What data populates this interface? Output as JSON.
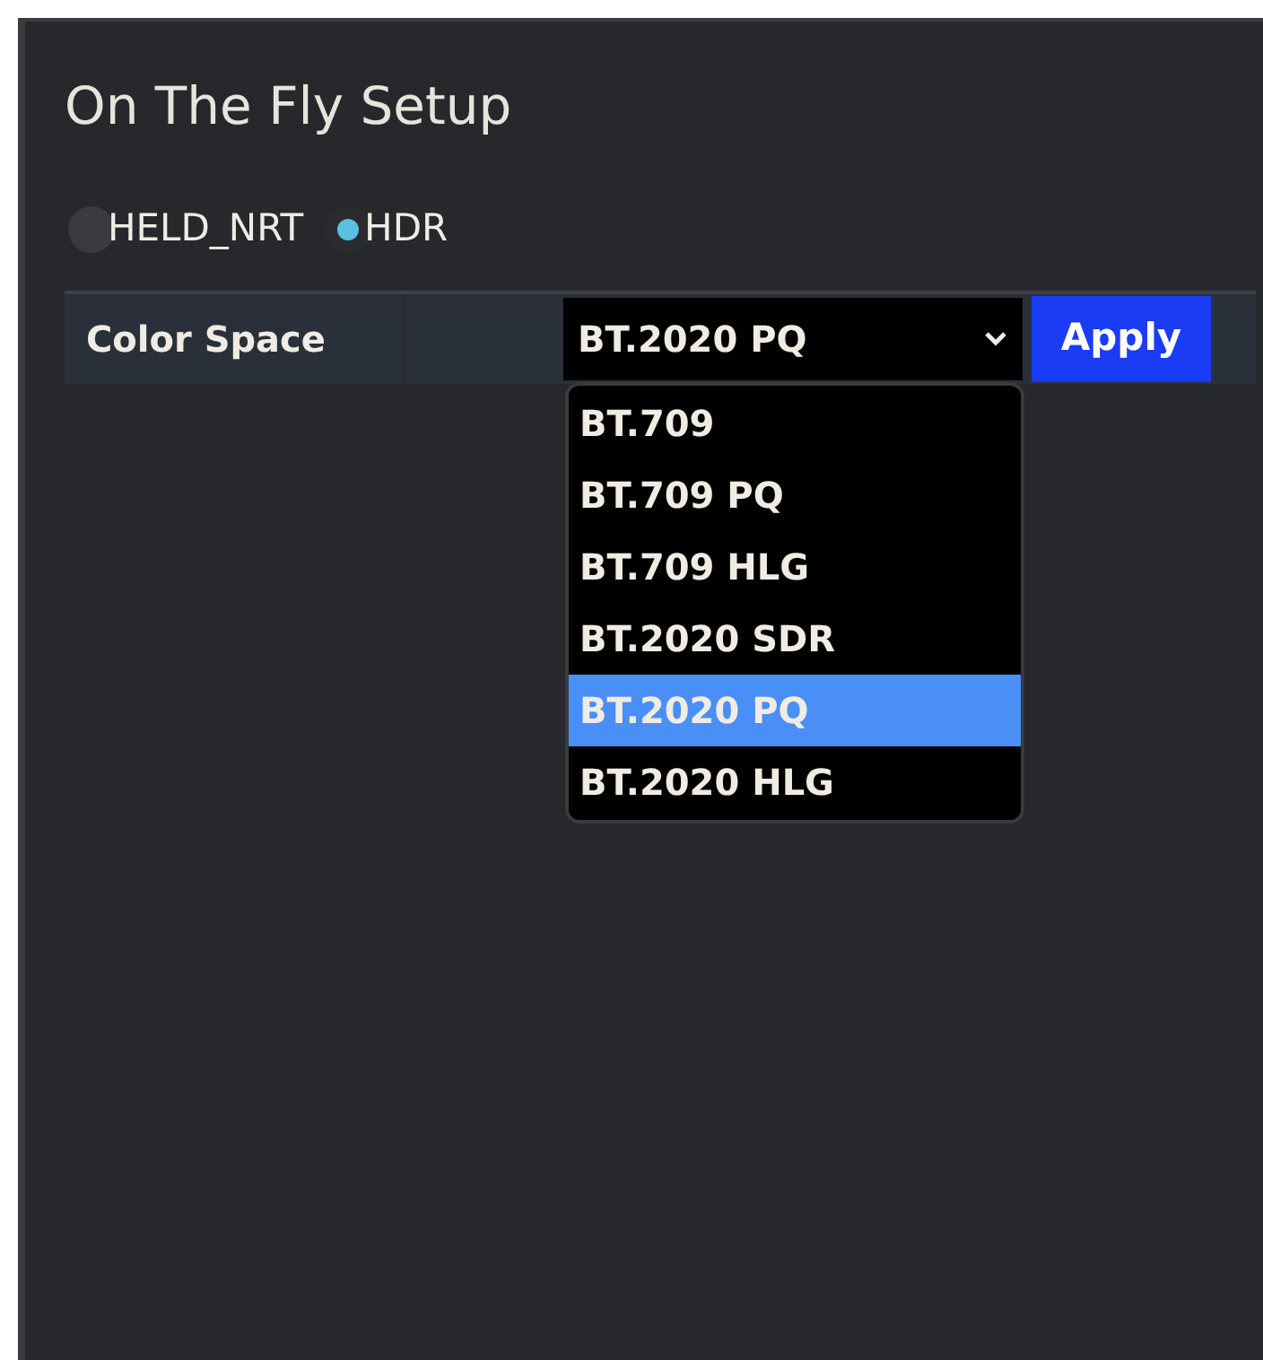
{
  "panel": {
    "title": "On The Fly Setup"
  },
  "modes": [
    {
      "label": "HELD_NRT",
      "selected": false
    },
    {
      "label": "HDR",
      "selected": true
    }
  ],
  "setting": {
    "label": "Color Space",
    "value": "BT.2020 PQ",
    "button": "Apply"
  },
  "dropdown": {
    "options": [
      {
        "label": "BT.709",
        "selected": false
      },
      {
        "label": "BT.709 PQ",
        "selected": false
      },
      {
        "label": "BT.709 HLG",
        "selected": false
      },
      {
        "label": "BT.2020 SDR",
        "selected": false
      },
      {
        "label": "BT.2020 PQ",
        "selected": true
      },
      {
        "label": "BT.2020 HLG",
        "selected": false
      }
    ]
  }
}
